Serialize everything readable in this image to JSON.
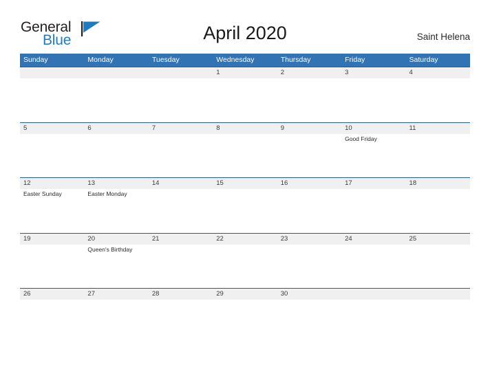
{
  "branding": {
    "logo_text_primary": "General",
    "logo_text_secondary": "Blue",
    "logo_primary_color": "#231f20",
    "logo_secondary_color": "#1f7bc1",
    "logo_flag_icon": "blue-triangle-flag-icon"
  },
  "header": {
    "title": "April 2020",
    "region": "Saint Helena"
  },
  "theme": {
    "header_blue": "#3273b4",
    "row_divider_blue": "#1f5c99",
    "date_band_gray": "#f0f0f0",
    "text_dark": "#2b2b2b",
    "background": "#ffffff"
  },
  "calendar": {
    "month": "April",
    "year": "2020",
    "weekday_headers": [
      "Sunday",
      "Monday",
      "Tuesday",
      "Wednesday",
      "Thursday",
      "Friday",
      "Saturday"
    ],
    "weeks": [
      {
        "dates": [
          "",
          "",
          "",
          "1",
          "2",
          "3",
          "4"
        ],
        "events": [
          [],
          [],
          [],
          [],
          [],
          [],
          []
        ]
      },
      {
        "dates": [
          "5",
          "6",
          "7",
          "8",
          "9",
          "10",
          "11"
        ],
        "events": [
          [],
          [],
          [],
          [],
          [],
          [
            "Good Friday"
          ],
          []
        ]
      },
      {
        "dates": [
          "12",
          "13",
          "14",
          "15",
          "16",
          "17",
          "18"
        ],
        "events": [
          [
            "Easter Sunday"
          ],
          [
            "Easter Monday"
          ],
          [],
          [],
          [],
          [],
          []
        ]
      },
      {
        "dates": [
          "19",
          "20",
          "21",
          "22",
          "23",
          "24",
          "25"
        ],
        "events": [
          [],
          [
            "Queen's Birthday"
          ],
          [],
          [],
          [],
          [],
          []
        ]
      },
      {
        "dates": [
          "26",
          "27",
          "28",
          "29",
          "30",
          "",
          ""
        ],
        "events": [
          [],
          [],
          [],
          [],
          [],
          [],
          []
        ]
      }
    ]
  }
}
